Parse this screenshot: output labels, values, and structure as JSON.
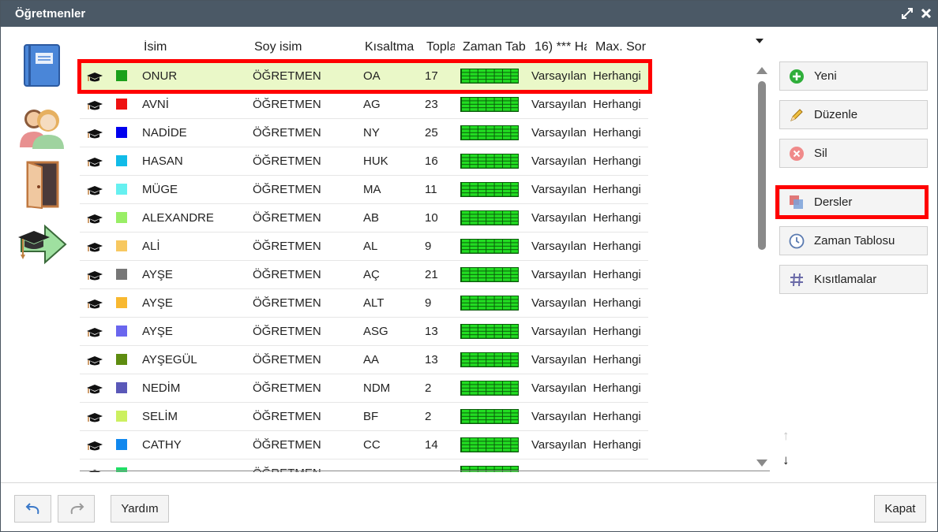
{
  "window": {
    "title": "Öğretmenler",
    "maximize_icon": "expand-icon",
    "close_icon": "close-icon"
  },
  "sidebar": {
    "items": [
      {
        "name": "notebook",
        "icon": "notebook-icon"
      },
      {
        "name": "teachers",
        "icon": "people-icon"
      },
      {
        "name": "door",
        "icon": "door-icon"
      },
      {
        "name": "next",
        "icon": "graduation-arrow-icon"
      }
    ]
  },
  "table": {
    "columns": [
      "İsim",
      "Soy isim",
      "Kısaltma",
      "Topla",
      "Zaman Tab",
      "16) *** Ha",
      "Max. Sor"
    ],
    "rows": [
      {
        "color": "#1aa01a",
        "name": "ONUR",
        "surname": "ÖĞRETMEN",
        "short": "OA",
        "total": "17",
        "c6": "Varsayılan",
        "c7": "Herhangi",
        "selected": true
      },
      {
        "color": "#ee1111",
        "name": "AVNİ",
        "surname": "ÖĞRETMEN",
        "short": "AG",
        "total": "23",
        "c6": "Varsayılan",
        "c7": "Herhangi"
      },
      {
        "color": "#0000ee",
        "name": "NADİDE",
        "surname": "ÖĞRETMEN",
        "short": "NY",
        "total": "25",
        "c6": "Varsayılan",
        "c7": "Herhangi"
      },
      {
        "color": "#11bbe8",
        "name": "HASAN",
        "surname": "ÖĞRETMEN",
        "short": "HUK",
        "total": "16",
        "c6": "Varsayılan",
        "c7": "Herhangi"
      },
      {
        "color": "#66f0f0",
        "name": "MÜGE",
        "surname": "ÖĞRETMEN",
        "short": "MA",
        "total": "11",
        "c6": "Varsayılan",
        "c7": "Herhangi"
      },
      {
        "color": "#99ee66",
        "name": "ALEXANDRE",
        "surname": "ÖĞRETMEN",
        "short": "AB",
        "total": "10",
        "c6": "Varsayılan",
        "c7": "Herhangi"
      },
      {
        "color": "#f7c860",
        "name": "ALİ",
        "surname": "ÖĞRETMEN",
        "short": "AL",
        "total": "9",
        "c6": "Varsayılan",
        "c7": "Herhangi"
      },
      {
        "color": "#777777",
        "name": "AYŞE",
        "surname": "ÖĞRETMEN",
        "short": "AÇ",
        "total": "21",
        "c6": "Varsayılan",
        "c7": "Herhangi"
      },
      {
        "color": "#f8b830",
        "name": "AYŞE",
        "surname": "ÖĞRETMEN",
        "short": "ALT",
        "total": "9",
        "c6": "Varsayılan",
        "c7": "Herhangi"
      },
      {
        "color": "#6a66ee",
        "name": "AYŞE",
        "surname": "ÖĞRETMEN",
        "short": "ASG",
        "total": "13",
        "c6": "Varsayılan",
        "c7": "Herhangi"
      },
      {
        "color": "#5e8c10",
        "name": "AYŞEGÜL",
        "surname": "ÖĞRETMEN",
        "short": "AA",
        "total": "13",
        "c6": "Varsayılan",
        "c7": "Herhangi"
      },
      {
        "color": "#5a58b8",
        "name": "NEDİM",
        "surname": "ÖĞRETMEN",
        "short": "NDM",
        "total": "2",
        "c6": "Varsayılan",
        "c7": "Herhangi"
      },
      {
        "color": "#ccf060",
        "name": "SELİM",
        "surname": "ÖĞRETMEN",
        "short": "BF",
        "total": "2",
        "c6": "Varsayılan",
        "c7": "Herhangi"
      },
      {
        "color": "#1188ee",
        "name": "CATHY",
        "surname": "ÖĞRETMEN",
        "short": "CC",
        "total": "14",
        "c6": "Varsayılan",
        "c7": "Herhangi"
      },
      {
        "color": "#22dd66",
        "name": "",
        "surname": "ÖĞRETMEN",
        "short": "",
        "total": "",
        "c6": "",
        "c7": ""
      }
    ]
  },
  "actions": [
    {
      "label": "Yeni",
      "icon": "plus-circle-icon"
    },
    {
      "label": "Düzenle",
      "icon": "pencil-icon"
    },
    {
      "label": "Sil",
      "icon": "delete-circle-icon"
    },
    {
      "label": "Dersler",
      "icon": "lessons-icon"
    },
    {
      "label": "Zaman Tablosu",
      "icon": "clock-icon"
    },
    {
      "label": "Kısıtlamalar",
      "icon": "hash-icon"
    }
  ],
  "sort_arrows": {
    "up": "↑",
    "down": "↓"
  },
  "footer": {
    "undo_icon": "undo-icon",
    "redo_icon": "redo-icon",
    "help_label": "Yardım",
    "close_label": "Kapat"
  },
  "colors": {
    "titlebar": "#4b5966",
    "selected_row": "#eaf8c8",
    "highlight_frame": "#ff0000",
    "timetable_green": "#22dd22"
  }
}
